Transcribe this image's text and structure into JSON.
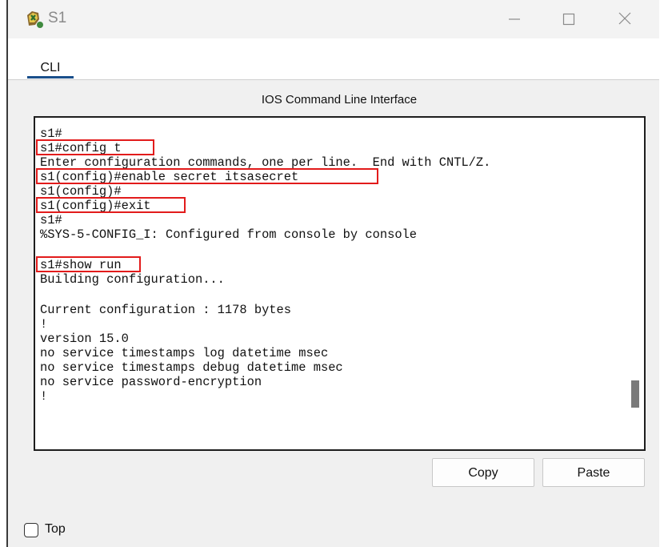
{
  "window": {
    "title": "S1",
    "icons": {
      "app": "switch-device-icon",
      "minimize": "minimize-icon",
      "maximize": "maximize-icon",
      "close": "close-icon"
    }
  },
  "tabs": [
    {
      "label": "CLI",
      "active": true
    }
  ],
  "panel": {
    "title": "IOS Command Line Interface"
  },
  "terminal": {
    "lines": [
      "s1#",
      "s1#config t",
      "Enter configuration commands, one per line.  End with CNTL/Z.",
      "s1(config)#enable secret itsasecret",
      "s1(config)#",
      "s1(config)#exit",
      "s1#",
      "%SYS-5-CONFIG_I: Configured from console by console",
      "",
      "s1#show run",
      "Building configuration...",
      "",
      "Current configuration : 1178 bytes",
      "!",
      "version 15.0",
      "no service timestamps log datetime msec",
      "no service timestamps debug datetime msec",
      "no service password-encryption",
      "!"
    ],
    "highlighted_commands": [
      "s1#config t",
      "s1(config)#enable secret itsasecret",
      "s1(config)#exit",
      "s1#show run"
    ],
    "highlight_color": "#e21b1b"
  },
  "buttons": {
    "copy": "Copy",
    "paste": "Paste"
  },
  "footer": {
    "top_checkbox_label": "Top",
    "top_checked": false
  }
}
